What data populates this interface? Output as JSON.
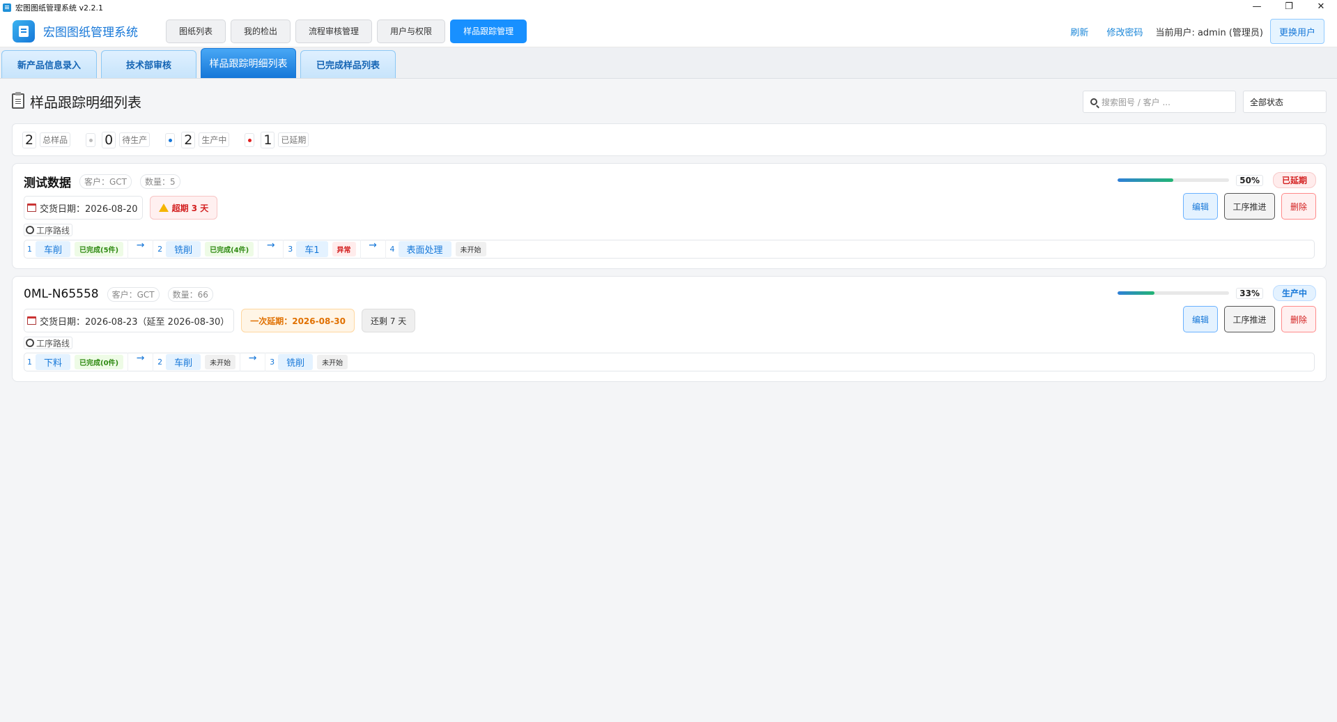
{
  "window": {
    "title": "宏图图纸管理系统  v2.2.1",
    "minimize": "—",
    "restore": "❐",
    "close": "✕"
  },
  "header": {
    "app_name": "宏图图纸管理系统",
    "nav": [
      "图纸列表",
      "我的检出",
      "流程审核管理",
      "用户与权限",
      "样品跟踪管理"
    ],
    "active_nav": 4,
    "refresh": "刷新",
    "change_password": "修改密码",
    "current_user": "当前用户: admin (管理员)",
    "switch_user": "更换用户"
  },
  "subtabs": [
    "新产品信息录入",
    "技术部审核",
    "样品跟踪明细列表",
    "已完成样品列表"
  ],
  "active_subtab": 2,
  "page": {
    "title": "样品跟踪明细列表",
    "search_placeholder": "搜索图号 / 客户 ...",
    "status_filter": "全部状态"
  },
  "stats": [
    {
      "value": "2",
      "label": "总样品",
      "color": ""
    },
    {
      "value": "0",
      "label": "待生产",
      "color": "#bbbbbb"
    },
    {
      "value": "2",
      "label": "生产中",
      "color": "#1677d8"
    },
    {
      "value": "1",
      "label": "已延期",
      "color": "#e02020"
    }
  ],
  "cards": [
    {
      "title": "测试数据",
      "customer": "客户：GCT",
      "quantity": "数量：5",
      "date": "交货日期：2026-08-20",
      "overdue": "超期 3 天",
      "route_label": "工序路线",
      "progress": 50,
      "progress_text": "50%",
      "status": "已延期",
      "steps": [
        {
          "no": "1",
          "name": "车削",
          "state": "已完成(5件)",
          "type": "done"
        },
        {
          "no": "2",
          "name": "铣削",
          "state": "已完成(4件)",
          "type": "done"
        },
        {
          "no": "3",
          "name": "车1",
          "state": "异常",
          "type": "abn"
        },
        {
          "no": "4",
          "name": "表面处理",
          "state": "未开始",
          "type": "todo"
        }
      ],
      "actions": {
        "edit": "编辑",
        "advance": "工序推进",
        "delete": "删除"
      }
    },
    {
      "title": "0ML-N65558",
      "customer": "客户：GCT",
      "quantity": "数量：66",
      "date": "交货日期：2026-08-23（延至 2026-08-30）",
      "delay": "一次延期：2026-08-30",
      "remaining": "还剩 7 天",
      "route_label": "工序路线",
      "progress": 33,
      "progress_text": "33%",
      "status": "生产中",
      "steps": [
        {
          "no": "1",
          "name": "下料",
          "state": "已完成(0件)",
          "type": "done"
        },
        {
          "no": "2",
          "name": "车削",
          "state": "未开始",
          "type": "todo"
        },
        {
          "no": "3",
          "name": "铣削",
          "state": "未开始",
          "type": "todo"
        }
      ],
      "actions": {
        "edit": "编辑",
        "advance": "工序推进",
        "delete": "删除"
      }
    }
  ],
  "colors": {
    "accent": "#1890ff",
    "late": "#d32020",
    "done": "#2f8a12"
  }
}
